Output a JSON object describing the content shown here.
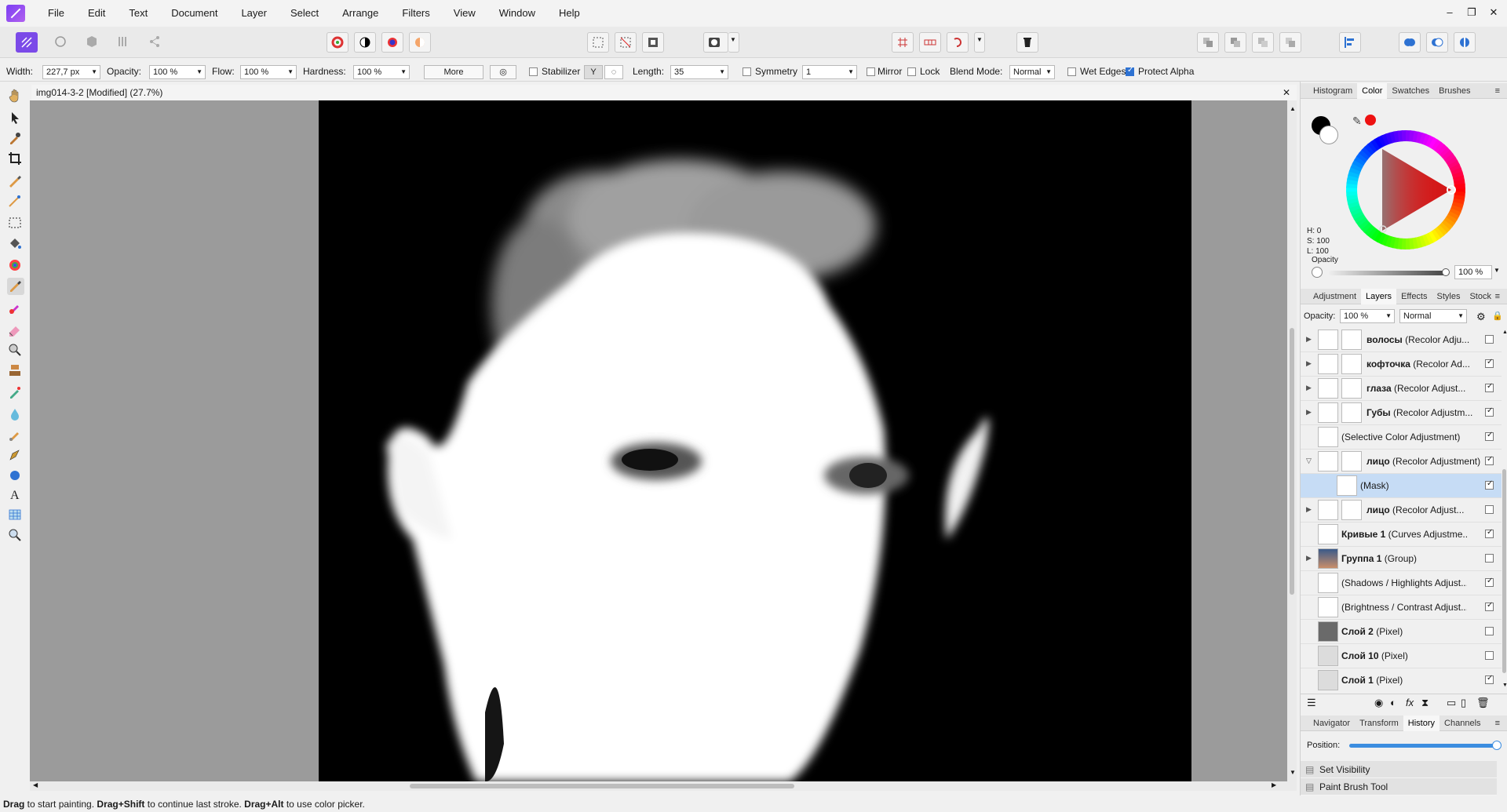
{
  "menu": [
    "File",
    "Edit",
    "Text",
    "Document",
    "Layer",
    "Select",
    "Arrange",
    "Filters",
    "View",
    "Window",
    "Help"
  ],
  "window_controls": [
    "–",
    "❐",
    "✕"
  ],
  "context_bar": {
    "width_label": "Width:",
    "width_value": "227,7 px",
    "opacity_label": "Opacity:",
    "opacity_value": "100 %",
    "flow_label": "Flow:",
    "flow_value": "100 %",
    "hardness_label": "Hardness:",
    "hardness_value": "100 %",
    "more_label": "More",
    "stabilizer_label": "Stabilizer",
    "length_label": "Length:",
    "length_value": "35",
    "symmetry_label": "Symmetry",
    "symmetry_value": "1",
    "mirror_label": "Mirror",
    "lock_label": "Lock",
    "blend_label": "Blend Mode:",
    "blend_value": "Normal",
    "wet_edges_label": "Wet Edges",
    "protect_alpha_label": "Protect Alpha"
  },
  "document": {
    "tab_title": "img014-3-2 [Modified] (27.7%)",
    "close": "✕"
  },
  "color_panel": {
    "tabs": [
      "Histogram",
      "Color",
      "Swatches",
      "Brushes"
    ],
    "active_tab": "Color",
    "hsl": [
      "H: 0",
      "S: 100",
      "L: 100"
    ],
    "opacity_label": "Opacity",
    "opacity_value": "100 %"
  },
  "layers_panel": {
    "tabs": [
      "Adjustment",
      "Layers",
      "Effects",
      "Styles",
      "Stock"
    ],
    "active_tab": "Layers",
    "opacity_label": "Opacity:",
    "opacity_value": "100 %",
    "blend_value": "Normal",
    "layers": [
      {
        "bold": "волосы",
        "rest": " (Recolor Adju...",
        "expand": true,
        "visible": false
      },
      {
        "bold": "кофточка",
        "rest": " (Recolor Ad...",
        "expand": true,
        "visible": true
      },
      {
        "bold": "глаза",
        "rest": " (Recolor Adjust...",
        "expand": true,
        "visible": true
      },
      {
        "bold": "Губы",
        "rest": " (Recolor Adjustm...",
        "expand": true,
        "visible": true
      },
      {
        "bold": "",
        "rest": "(Selective Color Adjustment)",
        "expand": false,
        "visible": true
      },
      {
        "bold": "лицо",
        "rest": " (Recolor Adjustment)",
        "expand": true,
        "visible": true
      },
      {
        "bold": "",
        "rest": "(Mask)",
        "expand": false,
        "visible": true
      },
      {
        "bold": "лицо",
        "rest": " (Recolor Adjust...",
        "expand": true,
        "visible": false
      },
      {
        "bold": "Кривые 1",
        "rest": " (Curves Adjustme...",
        "expand": false,
        "visible": true
      },
      {
        "bold": "Группа 1",
        "rest": " (Group)",
        "expand": true,
        "visible": false
      },
      {
        "bold": "",
        "rest": "(Shadows / Highlights Adjust...",
        "expand": false,
        "visible": true
      },
      {
        "bold": "",
        "rest": "(Brightness / Contrast Adjust...",
        "expand": false,
        "visible": true
      },
      {
        "bold": "Слой 2",
        "rest": " (Pixel)",
        "expand": false,
        "visible": false
      },
      {
        "bold": "Слой 10",
        "rest": " (Pixel)",
        "expand": false,
        "visible": false
      },
      {
        "bold": "Слой 1",
        "rest": " (Pixel)",
        "expand": false,
        "visible": true
      }
    ]
  },
  "history_panel": {
    "tabs": [
      "Navigator",
      "Transform",
      "History",
      "Channels"
    ],
    "active_tab": "History",
    "position_label": "Position:",
    "position_fraction": 1.0,
    "items": [
      "Set Visibility",
      "Paint Brush Tool"
    ]
  },
  "status": {
    "d1": "Drag",
    "t1": " to start painting. ",
    "d2": "Drag+Shift",
    "t2": " to continue last stroke. ",
    "d3": "Drag+Alt",
    "t3": " to use color picker."
  },
  "colors": {
    "accent": "#2e72d2",
    "selection": "#c6dcf5",
    "canvas_bg": "#9b9b9b",
    "logo": "#8a4af3"
  }
}
